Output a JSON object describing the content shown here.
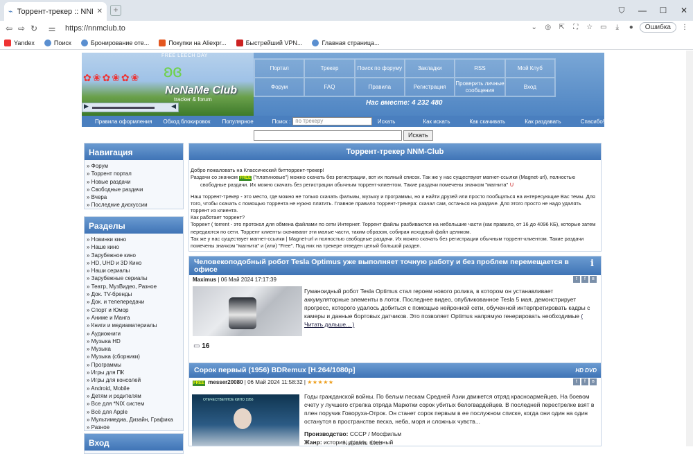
{
  "browser": {
    "tab_title": "Торрент-трекер :: NNM-Club",
    "url": "https://nnmclub.to",
    "error_button": "Ошибка",
    "bookmarks": [
      "Yandex",
      "Поиск",
      "Бронирование оте...",
      "Покупки на Aliexpr...",
      "Быстрейший VPN...",
      "Главная страница..."
    ]
  },
  "header": {
    "free_leech": "FREE LEECH DAY",
    "logo_name": "NoNaMe Club",
    "logo_sub": "tracker & forum",
    "menu": [
      "Портал",
      "Трекер",
      "Поиск по форуму",
      "Закладки",
      "RSS",
      "Мой Клуб",
      "Форум",
      "FAQ",
      "Правила",
      "Регистрация",
      "Проверить личные сообщения",
      "Вход"
    ],
    "online": "Нас вместе: 4 232 480",
    "subnav": {
      "rules": "Правила оформления",
      "bypass": "Обход блокировок",
      "popular": "Популярное",
      "search_label": "Поиск :",
      "search_placeholder": "по трекеру",
      "search_btn": "Искать",
      "how_search": "Как искать",
      "how_download": "Как скачивать",
      "how_seed": "Как раздавать",
      "thanks": "Спасибо!"
    },
    "main_search_btn": "Искать"
  },
  "sidebar": {
    "nav_title": "Навигация",
    "nav_items": [
      "Форум",
      "Торрент портал",
      "Новые раздачи",
      "Свободные раздачи",
      "Вчера",
      "Последние дискуссии"
    ],
    "sections_title": "Разделы",
    "sections_items": [
      "Новинки кино",
      "Наше кино",
      "Зарубежное кино",
      "HD, UHD и 3D Кино",
      "Наши сериалы",
      "Зарубежные сериалы",
      "Театр, МузВидео, Разное",
      "Док. TV-бренды",
      "Док. и телепередачи",
      "Спорт и Юмор",
      "Аниме и Манга",
      "Книги и медиаматериалы",
      "Аудиокниги",
      "Музыка HD",
      "Музыка",
      "Музыка (сборники)",
      "Программы",
      "Игры для ПК",
      "Игры для консолей",
      "Android, Mobile",
      "Детям и родителям",
      "Все для *NIX систем",
      "Всё для Apple",
      "Мультимедиа, Дизайн, Графика",
      "Разное"
    ],
    "login_title": "Вход"
  },
  "welcome": {
    "title": "Торрент-трекер NNM-Club",
    "l1": "Добро пожаловать на Классический битторрент-трекер!",
    "l2a": "Раздачи со значком ",
    "free": "FREE",
    "l2b": " (\"платиновые\") можно скачать без регистрации, вот их полный список. Так же у нас существуют магнет-ссылки (Magnet-url), полностью",
    "l3": "свободные раздачи. Их можно скачать без регистрации обычным торрент-клиентом. Такие раздачи помечены значком \"магнита\"",
    "l4": "Наш торрент-трекер - это место, где можно не только скачать фильмы, музыку и программы, но и найти друзей или просто пообщаться на интересующие Вас темы. Для того, чтобы скачать с помощью торрента не нужно платить. Главное правило торрент-трекера: скачал сам, останься на раздаче. Для этого просто не надо удалять торрент из клиента.",
    "l5": "Как работает торрент?",
    "l6": "Торрент ( torrent - это протокол для обмена файлами по сети Интернет. Торрент файлы разбиваются на небольшие части (как правило, от 16 до 4096 КБ), которые затем передаются по сети. Торрент клиенты скачивают эти малые части, таким образом, собирая исходный файл целиком.",
    "l7": "Так же у нас существует магнет-ссылки | Magnet-url и полностью свободные раздачи. Их можно скачать без регистрации обычным торрент-клиентом. Такие раздачи помечены значком \"магнита\" и (или) \"Free\". Под них на трекере отведен целый большой раздел."
  },
  "news1": {
    "title": "Человекоподобный робот Tesla Optimus уже выполняет точную работу и без проблем перемещается в офисе",
    "author": "Maximus",
    "date": "| 06 Май 2024 17:17:39",
    "text": "Гуманоидный робот Tesla Optimus стал героем нового ролика, в котором он устанавливает аккумуляторные элементы в лоток. Последнее видео, опубликованное Tesla 5 мая, демонстрирует прогресс, которого удалось добиться с помощью нейронной сети, обученной интерпретировать кадры с камеры и данные бортовых датчиков. Это позволяет Optimus напрямую генерировать необходимые",
    "read_more": "( Читать дальше... )",
    "comments": "16"
  },
  "news2": {
    "title": "Сорок первый (1956) BDRemux [H.264/1080p]",
    "hd": "HD DVD",
    "free": "FREE",
    "author": "messer20080",
    "date": "| 06 Май 2024 11:58:32 |",
    "stars": "★★★★★",
    "poster_title": "ОТЕЧЕСТВЕННОЕ КИНО 1956",
    "text": "Годы гражданской войны. По белым пескам Средней Азии движется отряд красноармейцев. На боевом счету у лучшего стрелка отряда Марютки сорок убитых белогвардейцев. В последней перестрелке взят в плен поручик Говоруха-Отрок. Он станет сорок первым в ее послужном списке, когда они один на один останутся в пространстве песка, неба, моря и сложных чувств...",
    "producer_label": "Производство:",
    "producer": "СССР / Мосфильм",
    "genre_label": "Жанр:",
    "genre": "история, драма, военный",
    "watermark": "NoNaMe Club"
  }
}
